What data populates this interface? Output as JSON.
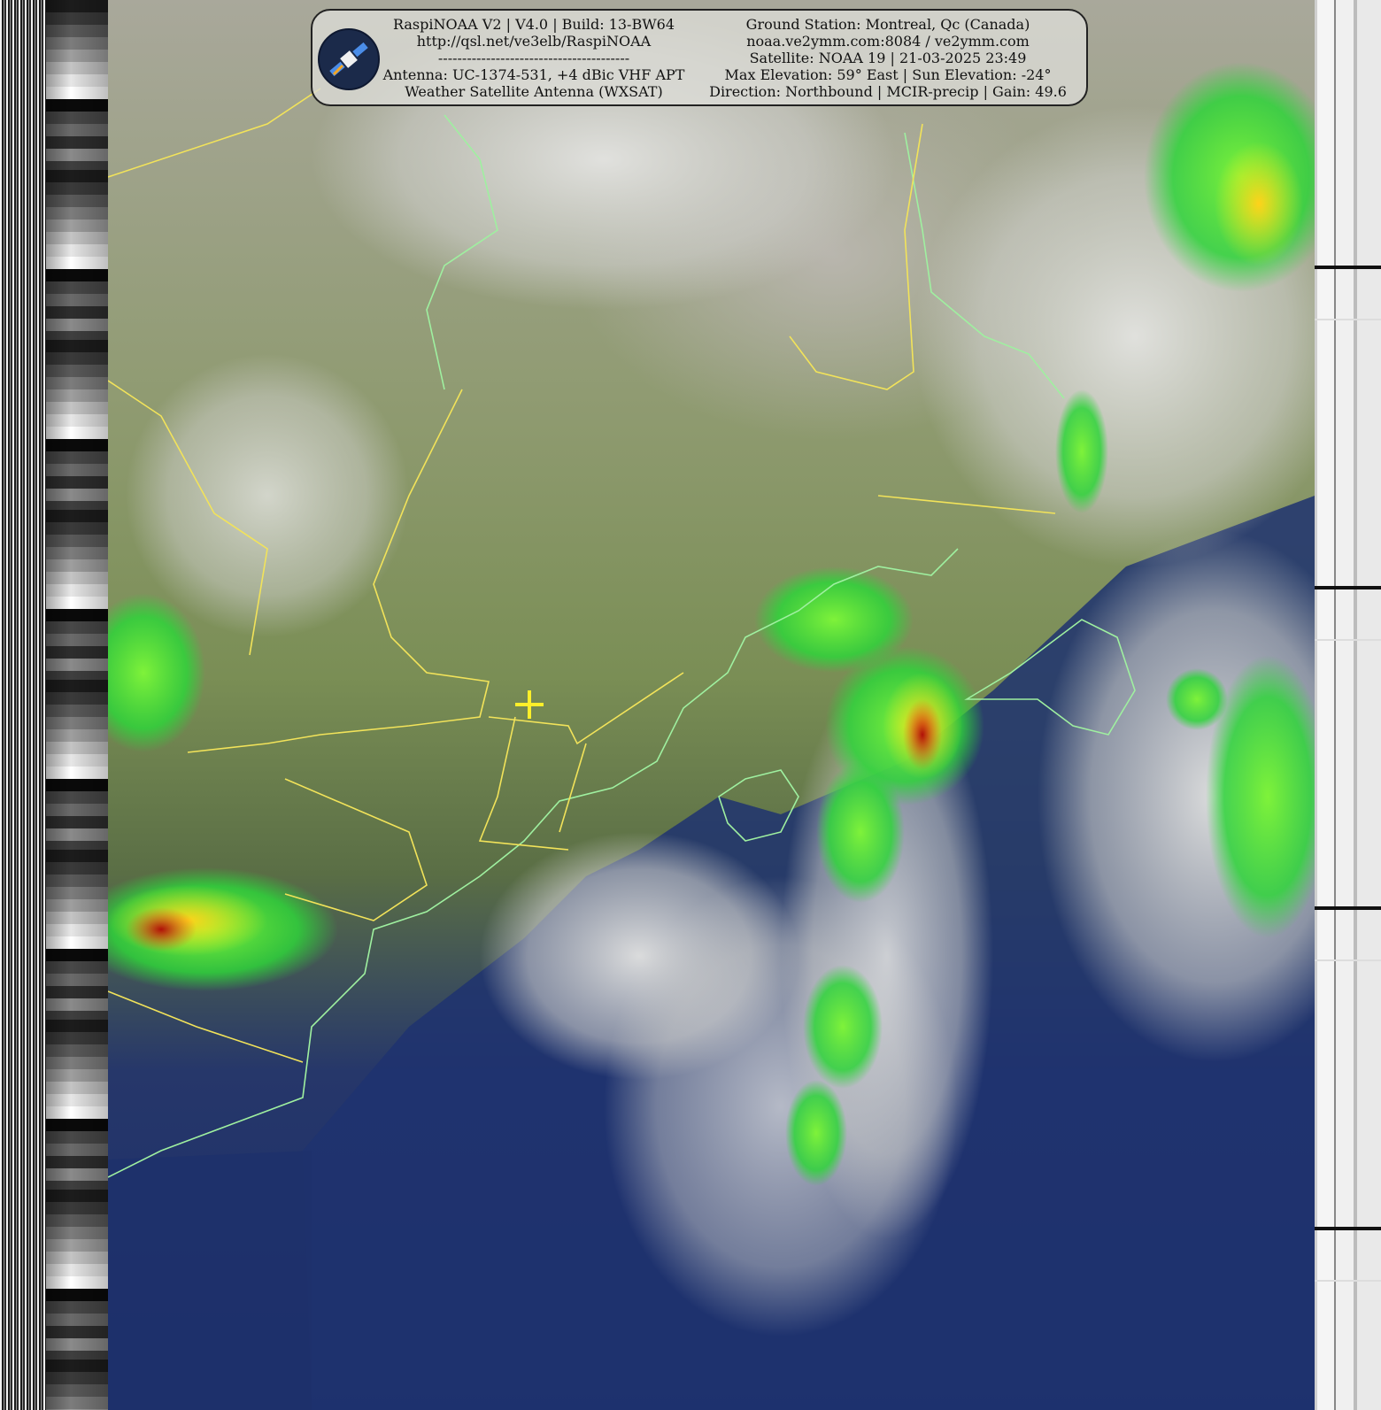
{
  "banner": {
    "left": {
      "line1": "RaspiNOAA V2 | V4.0 | Build: 13-BW64",
      "line2": "http://qsl.net/ve3elb/RaspiNOAA",
      "separator": "----------------------------------------",
      "line3": "Antenna: UC-1374-531, +4 dBic VHF APT",
      "line4": "Weather Satellite Antenna (WXSAT)"
    },
    "right": {
      "line1": "Ground Station: Montreal, Qc (Canada)",
      "line2": "noaa.ve2ymm.com:8084 / ve2ymm.com",
      "line3": "Satellite: NOAA 19 | 21-03-2025 23:49",
      "line4": "Max Elevation: 59° East | Sun Elevation: -24°",
      "line5": "Direction: Northbound | MCIR-precip | Gain: 49.6"
    }
  },
  "colors": {
    "land": "#7a8e55",
    "ocean": "#1a2d68",
    "cloud": "#c8c8c8",
    "precip_light": "#3ddc3d",
    "precip_moderate": "#f5e71a",
    "precip_heavy": "#d31e12",
    "border_line": "#f2e35a",
    "coastline": "#9ff0a0",
    "station_marker": "#ffef2a"
  },
  "icons": {
    "logo": "satellite-icon",
    "marker": "crosshair-icon"
  }
}
